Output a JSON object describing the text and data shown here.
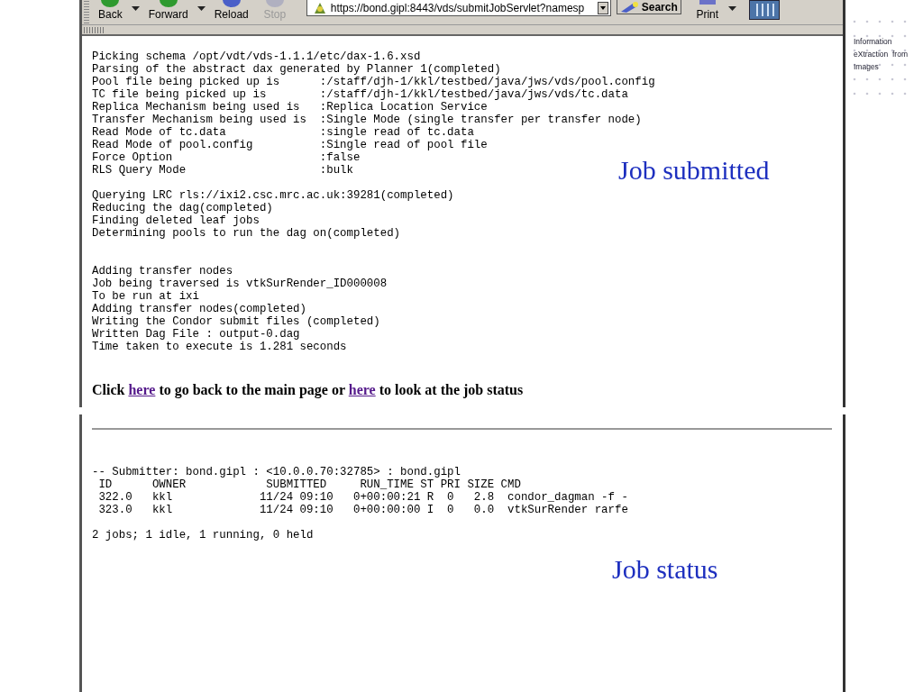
{
  "browser": {
    "toolbar": [
      {
        "label": "Back",
        "kind": "back",
        "disabled": false,
        "menu": true
      },
      {
        "label": "Forward",
        "kind": "forward",
        "disabled": false,
        "menu": true
      },
      {
        "label": "Reload",
        "kind": "reload",
        "disabled": false,
        "menu": false
      },
      {
        "label": "Stop",
        "kind": "stop",
        "disabled": true,
        "menu": false
      }
    ],
    "url": "https://bond.gipl:8443/vds/submitJobServlet?namesp",
    "search": "Search",
    "print": "Print"
  },
  "submit_output": [
    [
      "Picking schema /opt/vdt/vds-1.1.1/etc/dax-1.6.xsd",
      "Parsing of the abstract dax generated by Planner 1(completed)",
      "Pool file being picked up is      :/staff/djh-1/kkl/testbed/java/jws/vds/pool.config",
      "TC file being picked up is        :/staff/djh-1/kkl/testbed/java/jws/vds/tc.data",
      "Replica Mechanism being used is   :Replica Location Service",
      "Transfer Mechanism being used is  :Single Mode (single transfer per transfer node)",
      "Read Mode of tc.data              :single read of tc.data",
      "Read Mode of pool.config          :Single read of pool file",
      "Force Option                      :false",
      "RLS Query Mode                    :bulk"
    ],
    [
      "Querying LRC rls://ixi2.csc.mrc.ac.uk:39281(completed)",
      "Reducing the dag(completed)",
      "Finding deleted leaf jobs",
      "Determining pools to run the dag on(completed)"
    ],
    [
      "Adding transfer nodes",
      "Job being traversed is vtkSurRender_ID000008",
      "To be run at ixi",
      "Adding transfer nodes(completed)",
      "Writing the Condor submit files (completed)",
      "Written Dag File : output-0.dag",
      "Time taken to execute is 1.281 seconds"
    ]
  ],
  "link_sentence": [
    {
      "kind": "text",
      "text": "Click "
    },
    {
      "kind": "link",
      "text": "here"
    },
    {
      "kind": "text",
      "text": " to go back to the main page or "
    },
    {
      "kind": "link",
      "text": "here"
    },
    {
      "kind": "text",
      "text": " to look at the job status"
    }
  ],
  "caption_submitted": "Job submitted",
  "status_output": {
    "submitter": "-- Submitter: bond.gipl : <10.0.0.70:32785> : bond.gipl",
    "columns": " ID      OWNER            SUBMITTED     RUN_TIME ST PRI SIZE CMD",
    "rows": [
      " 322.0   kkl             11/24 09:10   0+00:00:21 R  0   2.8  condor_dagman -f -",
      " 323.0   kkl             11/24 09:10   0+00:00:00 I  0   0.0  vtkSurRender rarfe"
    ],
    "summary": "2 jobs; 1 idle, 1 running, 0 held"
  },
  "caption_status": "Job status",
  "logo": {
    "lines": [
      "Information",
      "eXtraction  from",
      "Images"
    ]
  }
}
